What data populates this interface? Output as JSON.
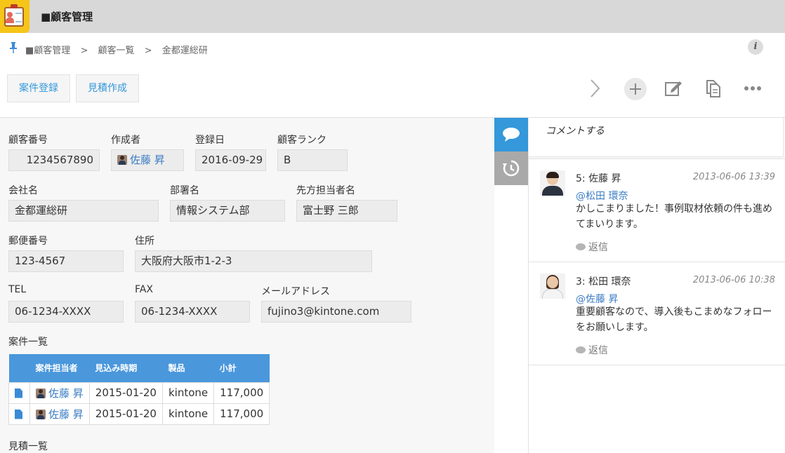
{
  "header": {
    "title": "■顧客管理"
  },
  "breadcrumb": [
    "■顧客管理",
    ">",
    "顧客一覧",
    ">",
    "金都運総研"
  ],
  "toolbar": {
    "buttons": [
      "案件登録",
      "見積作成"
    ],
    "icons": [
      "next-arrow-icon",
      "add-icon",
      "edit-icon",
      "copy-icon",
      "more-icon"
    ]
  },
  "form": {
    "customer_number": {
      "label": "顧客番号",
      "value": "1234567890"
    },
    "creator": {
      "label": "作成者",
      "value": "佐藤 昇"
    },
    "registered_date": {
      "label": "登録日",
      "value": "2016-09-29"
    },
    "customer_rank": {
      "label": "顧客ランク",
      "value": "B"
    },
    "company": {
      "label": "会社名",
      "value": "金都運総研"
    },
    "department": {
      "label": "部署名",
      "value": "情報システム部"
    },
    "contact_person": {
      "label": "先方担当者名",
      "value": "富士野 三郎"
    },
    "postal_code": {
      "label": "郵便番号",
      "value": "123-4567"
    },
    "address": {
      "label": "住所",
      "value": "大阪府大阪市1-2-3"
    },
    "tel": {
      "label": "TEL",
      "value": "06-1234-XXXX"
    },
    "fax": {
      "label": "FAX",
      "value": "06-1234-XXXX"
    },
    "email": {
      "label": "メールアドレス",
      "value": "fujino3@kintone.com"
    },
    "deals": {
      "label": "案件一覧",
      "columns": [
        "案件担当者",
        "見込み時期",
        "製品",
        "小計"
      ],
      "rows": [
        {
          "owner": "佐藤 昇",
          "date": "2015-01-20",
          "product": "kintone",
          "subtotal": "117,000"
        },
        {
          "owner": "佐藤 昇",
          "date": "2015-01-20",
          "product": "kintone",
          "subtotal": "117,000"
        }
      ]
    },
    "estimates": {
      "label": "見積一覧"
    }
  },
  "comments": {
    "placeholder": "コメントする",
    "items": [
      {
        "author": "5: 佐藤 昇",
        "time": "2013-06-06 13:39",
        "mention": "@松田 環奈",
        "text": "かしこまりました！事例取材依頼の件も進めてまいります。",
        "reply": "返信"
      },
      {
        "author": "3: 松田 環奈",
        "time": "2013-06-06 10:38",
        "mention": "@佐藤 昇",
        "text": "重要顧客なので、導入後もこまめなフォローをお願いします。",
        "reply": "返信"
      }
    ]
  },
  "colors": {
    "accent": "#3498db",
    "header_bg": "#d8d8d8",
    "app_icon": "#f5c518"
  }
}
